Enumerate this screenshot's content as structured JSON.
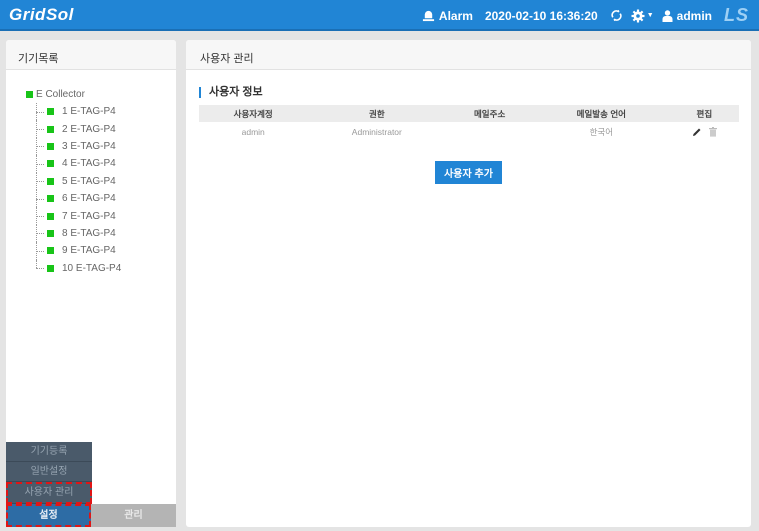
{
  "header": {
    "logo": "GridSol",
    "alarm_label": "Alarm",
    "datetime": "2020-02-10 16:36:20",
    "user": "admin",
    "brand": "LS",
    "icons": [
      "alarm-bell-icon",
      "refresh-icon",
      "gear-icon",
      "caret-down-icon",
      "user-icon"
    ]
  },
  "left_panel": {
    "title": "기기목록",
    "tree": {
      "root": "E Collector",
      "items": [
        {
          "label": "1 E-TAG-P4",
          "status_color": "#18c418"
        },
        {
          "label": "2 E-TAG-P4",
          "status_color": "#18c418"
        },
        {
          "label": "3 E-TAG-P4",
          "status_color": "#18c418"
        },
        {
          "label": "4 E-TAG-P4",
          "status_color": "#18c418"
        },
        {
          "label": "5 E-TAG-P4",
          "status_color": "#18c418"
        },
        {
          "label": "6 E-TAG-P4",
          "status_color": "#18c418"
        },
        {
          "label": "7 E-TAG-P4",
          "status_color": "#18c418"
        },
        {
          "label": "8 E-TAG-P4",
          "status_color": "#18c418"
        },
        {
          "label": "9 E-TAG-P4",
          "status_color": "#18c418"
        },
        {
          "label": "10 E-TAG-P4",
          "status_color": "#18c418"
        }
      ]
    },
    "submenu": [
      {
        "label": "기기등록",
        "active": false
      },
      {
        "label": "일반설정",
        "active": false
      },
      {
        "label": "사용자 관리",
        "active": true
      }
    ],
    "bottom_tabs": [
      {
        "label": "설정",
        "active": true
      },
      {
        "label": "관리",
        "active": false
      }
    ]
  },
  "main": {
    "title": "사용자 관리",
    "section_title": "사용자 정보",
    "table": {
      "columns": [
        "사용자계정",
        "권한",
        "메일주소",
        "메일발송 언어",
        "편집"
      ],
      "rows": [
        {
          "account": "admin",
          "role": "Administrator",
          "email": "",
          "language": "한국어",
          "actions": [
            "edit-pencil-icon",
            "trash-icon"
          ]
        }
      ]
    },
    "add_button": "사용자 추가"
  },
  "colors": {
    "accent": "#2185d5",
    "status_ok": "#18c418",
    "highlight": "#e01515"
  }
}
